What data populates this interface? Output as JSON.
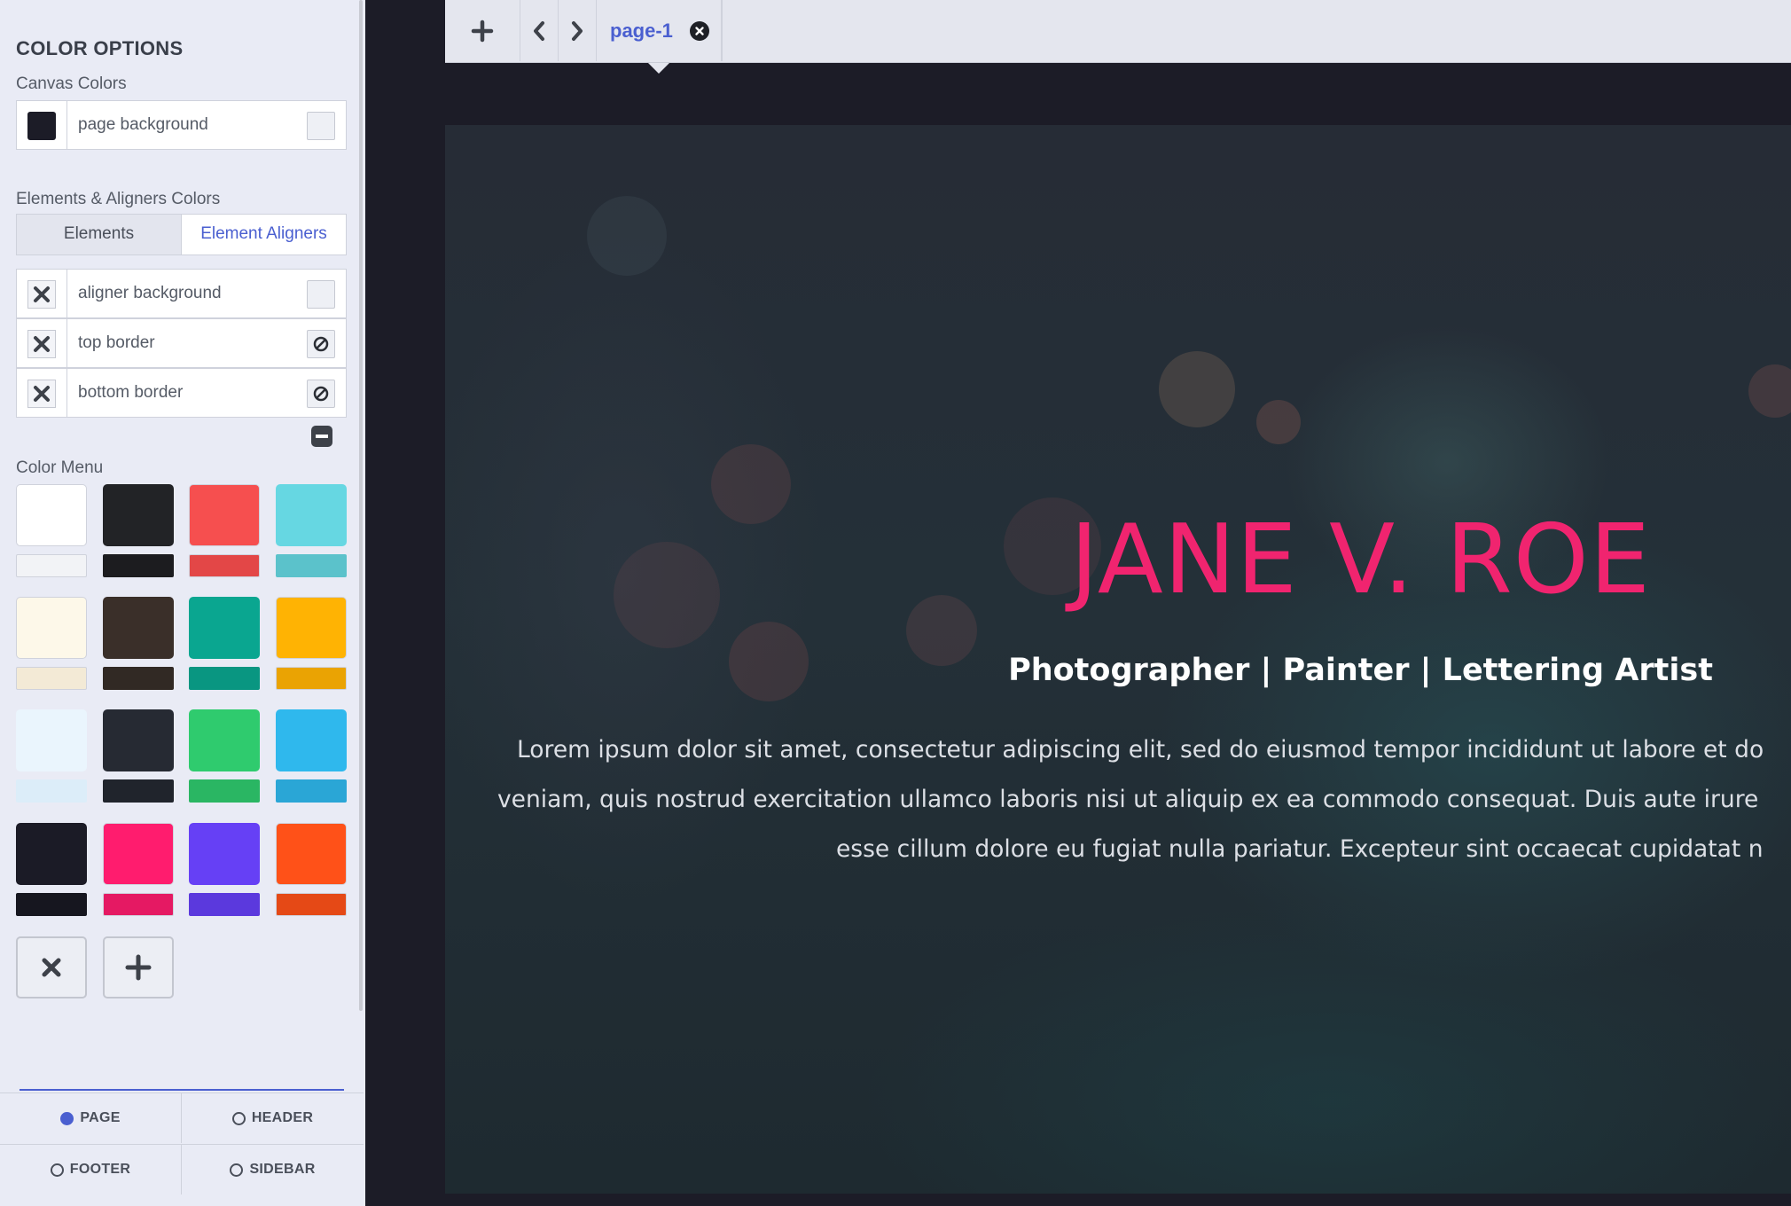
{
  "sidebar": {
    "title": "COLOR OPTIONS",
    "canvas_colors_label": "Canvas Colors",
    "canvas_rows": [
      {
        "label": "page background"
      }
    ],
    "elements_label": "Elements & Aligners Colors",
    "tabs": {
      "elements": "Elements",
      "aligners": "Element Aligners",
      "active": "aligners"
    },
    "aligner_rows": [
      {
        "label": "aligner background",
        "end_icon": "empty-swatch"
      },
      {
        "label": "top border",
        "end_icon": "none-icon"
      },
      {
        "label": "bottom border",
        "end_icon": "none-icon"
      }
    ],
    "color_menu_label": "Color Menu",
    "color_menu": [
      [
        "#ffffff",
        "#f2f3f6"
      ],
      [
        "#222326",
        "#1c1c1f"
      ],
      [
        "#f64f4f",
        "#e34747"
      ],
      [
        "#66d7e2",
        "#5bc2cb"
      ],
      [
        "#fdf8e9",
        "#f3ead6"
      ],
      [
        "#3a2f29",
        "#312924"
      ],
      [
        "#0aa690",
        "#099681"
      ],
      [
        "#ffb303",
        "#eaa303"
      ],
      [
        "#eaf5fd",
        "#dcedf9"
      ],
      [
        "#262a33",
        "#20242c"
      ],
      [
        "#2fcb6e",
        "#2ab663"
      ],
      [
        "#2fb8ed",
        "#2aa6d6"
      ],
      [
        "#1b1b26",
        "#16161f"
      ],
      [
        "#ff1c6e",
        "#e51963"
      ],
      [
        "#6640f5",
        "#5b39dd"
      ],
      [
        "#ff5118",
        "#e54916"
      ]
    ],
    "modes": [
      {
        "label": "PAGE",
        "selected": true
      },
      {
        "label": "HEADER",
        "selected": false
      },
      {
        "label": "FOOTER",
        "selected": false
      },
      {
        "label": "SIDEBAR",
        "selected": false
      }
    ]
  },
  "tabbar": {
    "page_tab": "page-1",
    "icons": [
      "plus-icon",
      "chevron-left-icon",
      "chevron-right-icon",
      "close-circle-icon"
    ]
  },
  "hero": {
    "name": "JANE V. ROE",
    "subtitle": "Photographer | Painter | Lettering Artist",
    "para_line1": "Lorem ipsum dolor sit amet, consectetur adipiscing elit, sed do eiusmod tempor incididunt ut labore et do",
    "para_line2": "veniam, quis nostrud exercitation ullamco laboris nisi ut aliquip ex ea commodo consequat. Duis aute irure",
    "para_line3": "esse cillum dolore eu fugiat nulla pariatur. Excepteur sint occaecat cupidatat n"
  },
  "colors": {
    "accent": "#4a5fd0",
    "canvas_bg": "#1c1c27",
    "hero_name": "#f0246f"
  }
}
